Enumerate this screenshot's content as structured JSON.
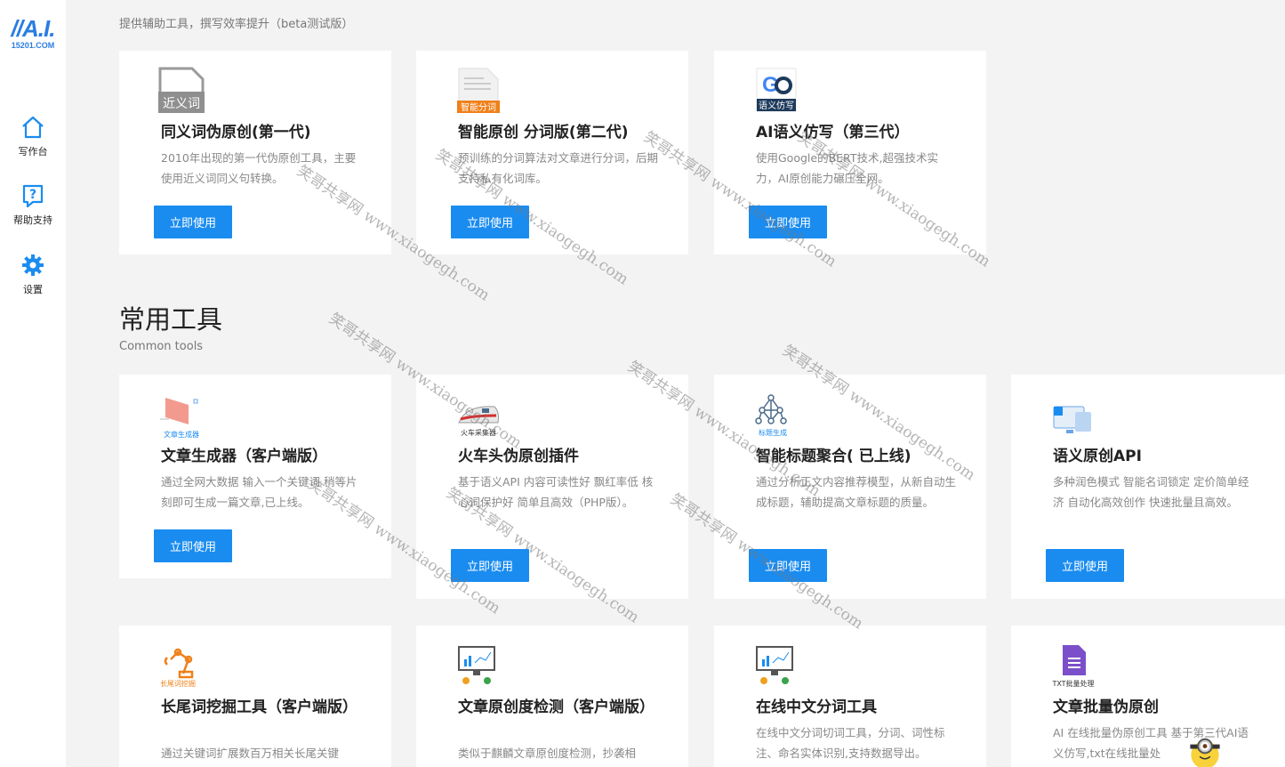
{
  "sidebar": {
    "logo": {
      "mark": "//A.I.",
      "sub": "15201.COM"
    },
    "items": [
      {
        "label": "写作台",
        "icon": "home-icon"
      },
      {
        "label": "帮助支持",
        "icon": "help-icon"
      },
      {
        "label": "设置",
        "icon": "gear-icon"
      }
    ]
  },
  "sections": {
    "top": {
      "subtitle": "提供辅助工具，撰写效率提升（beta测试版）"
    },
    "common": {
      "title": "常用工具",
      "subtitle": "Common tools"
    }
  },
  "cards": [
    {
      "title": "同义词伪原创(第一代)",
      "desc": "2010年出现的第一代伪原创工具，主要使用近义词同义句转换。",
      "button": "立即使用",
      "icon": "synonym-icon",
      "icon_text": "近义词"
    },
    {
      "title": "智能原创 分词版(第二代)",
      "desc": "预训练的分词算法对文章进行分词，后期支持私有化词库。",
      "button": "立即使用",
      "icon": "word-segment-doc-icon",
      "icon_text": "智能分词"
    },
    {
      "title": "AI语义仿写（第三代）",
      "desc": "使用Google的BERT技术,超强技术实力，AI原创能力碾压全网。",
      "button": "立即使用",
      "icon": "google-semantic-icon",
      "icon_text": "语义仿写"
    },
    {
      "title": "文章生成器（客户端版）",
      "desc": "通过全网大数据 输入一个关键词 稍等片刻即可生成一篇文章,已上线。",
      "button": "立即使用",
      "icon": "article-generator-icon",
      "icon_text": "文章生成器"
    },
    {
      "title": "火车头伪原创插件",
      "desc": "基于语义API 内容可读性好 飘红率低 核心词保护好 简单且高效（PHP版）。",
      "button": "立即使用",
      "icon": "train-icon",
      "icon_text": "火车采集器"
    },
    {
      "title": "智能标题聚合( 已上线)",
      "desc": "通过分析正文内容推荐模型，从新自动生成标题，辅助提高文章标题的质量。",
      "button": "立即使用",
      "icon": "network-icon",
      "icon_text": "标题生成"
    },
    {
      "title": "语义原创API",
      "desc": "多种润色模式 智能名词锁定 定价简单经济 自动化高效创作 快速批量且高效。",
      "button": "立即使用",
      "icon": "api-icon",
      "icon_text": ""
    },
    {
      "title": "长尾词挖掘工具（客户端版）",
      "desc": "通过关键词扩展数百万相关长尾关键",
      "icon": "robot-arm-icon",
      "icon_text": "长尾词挖掘"
    },
    {
      "title": "文章原创度检测（客户端版）",
      "desc": "类似于麒麟文章原创度检测，抄袭相",
      "icon": "chart-board-icon",
      "icon_text": ""
    },
    {
      "title": "在线中文分词工具",
      "desc": "在线中文分词切词工具，分词、词性标注、命名实体识别,支持数据导出。",
      "icon": "chart-board-icon",
      "icon_text": ""
    },
    {
      "title": "文章批量伪原创",
      "desc": "AI 在线批量伪原创工具 基于第三代AI语义仿写,txt在线批量处",
      "icon": "txt-batch-icon",
      "icon_text": "TXT批量处理"
    }
  ],
  "watermark": {
    "text": "笑哥共享网 www.xiaogegh.com"
  },
  "colors": {
    "accent": "#1a8cf0",
    "logo": "#2a7de1",
    "background": "#f3f3f3"
  }
}
